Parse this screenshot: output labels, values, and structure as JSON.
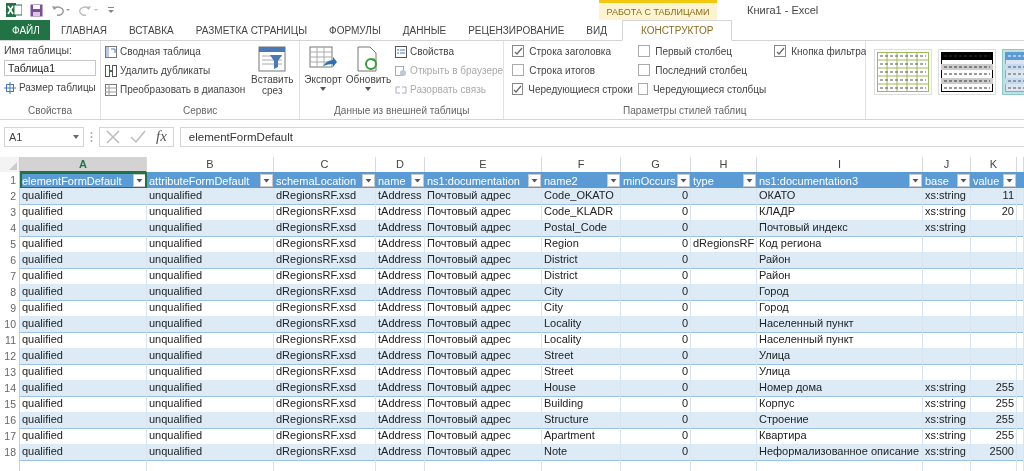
{
  "title_bar": {
    "title": "Книга1 - Excel",
    "context_group": "РАБОТА С ТАБЛИЦАМИ"
  },
  "tabs": [
    {
      "label": "ФАЙЛ",
      "kind": "file",
      "selected": false
    },
    {
      "label": "ГЛАВНАЯ",
      "kind": "normal",
      "selected": false
    },
    {
      "label": "ВСТАВКА",
      "kind": "normal",
      "selected": false
    },
    {
      "label": "РАЗМЕТКА СТРАНИЦЫ",
      "kind": "normal",
      "selected": false
    },
    {
      "label": "ФОРМУЛЫ",
      "kind": "normal",
      "selected": false
    },
    {
      "label": "ДАННЫЕ",
      "kind": "normal",
      "selected": false
    },
    {
      "label": "РЕЦЕНЗИРОВАНИЕ",
      "kind": "normal",
      "selected": false
    },
    {
      "label": "ВИД",
      "kind": "normal",
      "selected": false
    },
    {
      "label": "КОНСТРУКТОР",
      "kind": "context",
      "selected": true
    }
  ],
  "ribbon": {
    "properties": {
      "name_label": "Имя таблицы:",
      "name_value": "Таблица1",
      "resize": "Размер таблицы",
      "group": "Свойства"
    },
    "tools": {
      "items": [
        {
          "label": "Сводная таблица"
        },
        {
          "label": "Удалить дубликаты"
        },
        {
          "label": "Преобразовать в диапазон"
        }
      ],
      "slicer": "Вставить срез",
      "group": "Сервис"
    },
    "external": {
      "large": [
        {
          "label": "Экспорт"
        },
        {
          "label": "Обновить"
        }
      ],
      "items": [
        {
          "label": "Свойства",
          "disabled": false
        },
        {
          "label": "Открыть в браузере",
          "disabled": true
        },
        {
          "label": "Разорвать связь",
          "disabled": true
        }
      ],
      "group": "Данные из внешней таблицы"
    },
    "style_options": {
      "columns": [
        [
          {
            "label": "Строка заголовка",
            "checked": true
          },
          {
            "label": "Строка итогов",
            "checked": false
          },
          {
            "label": "Чередующиеся строки",
            "checked": true
          }
        ],
        [
          {
            "label": "Первый столбец",
            "checked": false
          },
          {
            "label": "Последний столбец",
            "checked": false
          },
          {
            "label": "Чередующиеся столбцы",
            "checked": false
          }
        ],
        [
          {
            "label": "Кнопка фильтра",
            "checked": true
          }
        ]
      ],
      "group": "Параметры стилей таблиц"
    }
  },
  "formula_bar": {
    "name_box": "A1",
    "fx": "fx",
    "value": "elementFormDefault"
  },
  "sheet": {
    "column_letters": [
      {
        "label": "A",
        "selected": true
      },
      {
        "label": "B",
        "selected": false
      },
      {
        "label": "C",
        "selected": false
      },
      {
        "label": "D",
        "selected": false
      },
      {
        "label": "E",
        "selected": false
      },
      {
        "label": "F",
        "selected": false
      },
      {
        "label": "G",
        "selected": false
      },
      {
        "label": "H",
        "selected": false
      },
      {
        "label": "I",
        "selected": false
      },
      {
        "label": "J",
        "selected": false
      },
      {
        "label": "K",
        "selected": false
      }
    ],
    "columns": [
      {
        "header": "elementFormDefault",
        "kind": "text",
        "active": true
      },
      {
        "header": "attributeFormDefault",
        "kind": "text",
        "active": false
      },
      {
        "header": "schemaLocation",
        "kind": "text",
        "active": false
      },
      {
        "header": "name",
        "kind": "text",
        "active": false
      },
      {
        "header": "ns1:documentation",
        "kind": "text",
        "active": false
      },
      {
        "header": "name2",
        "kind": "text",
        "active": false
      },
      {
        "header": "minOccurs",
        "kind": "number",
        "active": false
      },
      {
        "header": "type",
        "kind": "text",
        "active": false
      },
      {
        "header": "ns1:documentation3",
        "kind": "text",
        "active": false
      },
      {
        "header": "base",
        "kind": "text",
        "active": false
      },
      {
        "header": "value",
        "kind": "number",
        "active": false
      }
    ],
    "row_numbers": [
      "1",
      "2",
      "3",
      "4",
      "5",
      "6",
      "7",
      "8",
      "9",
      "10",
      "11",
      "12",
      "13",
      "14",
      "15",
      "16",
      "17",
      "18"
    ],
    "rows": [
      [
        "qualified",
        "unqualified",
        "dRegionsRF.xsd",
        "tAddress",
        "Почтовый адрес",
        "Code_OKATO",
        "0",
        null,
        "ОКАТО",
        "xs:string",
        "11"
      ],
      [
        "qualified",
        "unqualified",
        "dRegionsRF.xsd",
        "tAddress",
        "Почтовый адрес",
        "Code_KLADR",
        "0",
        null,
        "КЛАДР",
        "xs:string",
        "20"
      ],
      [
        "qualified",
        "unqualified",
        "dRegionsRF.xsd",
        "tAddress",
        "Почтовый адрес",
        "Postal_Code",
        "0",
        null,
        "Почтовый индекс",
        "xs:string",
        null
      ],
      [
        "qualified",
        "unqualified",
        "dRegionsRF.xsd",
        "tAddress",
        "Почтовый адрес",
        "Region",
        "0",
        "dRegionsRF",
        "Код региона",
        null,
        null
      ],
      [
        "qualified",
        "unqualified",
        "dRegionsRF.xsd",
        "tAddress",
        "Почтовый адрес",
        "District",
        "0",
        null,
        "Район",
        null,
        null
      ],
      [
        "qualified",
        "unqualified",
        "dRegionsRF.xsd",
        "tAddress",
        "Почтовый адрес",
        "District",
        "0",
        null,
        "Район",
        null,
        null
      ],
      [
        "qualified",
        "unqualified",
        "dRegionsRF.xsd",
        "tAddress",
        "Почтовый адрес",
        "City",
        "0",
        null,
        "Город",
        null,
        null
      ],
      [
        "qualified",
        "unqualified",
        "dRegionsRF.xsd",
        "tAddress",
        "Почтовый адрес",
        "City",
        "0",
        null,
        "Город",
        null,
        null
      ],
      [
        "qualified",
        "unqualified",
        "dRegionsRF.xsd",
        "tAddress",
        "Почтовый адрес",
        "Locality",
        "0",
        null,
        "Населенный пункт",
        null,
        null
      ],
      [
        "qualified",
        "unqualified",
        "dRegionsRF.xsd",
        "tAddress",
        "Почтовый адрес",
        "Locality",
        "0",
        null,
        "Населенный пункт",
        null,
        null
      ],
      [
        "qualified",
        "unqualified",
        "dRegionsRF.xsd",
        "tAddress",
        "Почтовый адрес",
        "Street",
        "0",
        null,
        "Улица",
        null,
        null
      ],
      [
        "qualified",
        "unqualified",
        "dRegionsRF.xsd",
        "tAddress",
        "Почтовый адрес",
        "Street",
        "0",
        null,
        "Улица",
        null,
        null
      ],
      [
        "qualified",
        "unqualified",
        "dRegionsRF.xsd",
        "tAddress",
        "Почтовый адрес",
        "House",
        "0",
        null,
        "Номер дома",
        "xs:string",
        "255"
      ],
      [
        "qualified",
        "unqualified",
        "dRegionsRF.xsd",
        "tAddress",
        "Почтовый адрес",
        "Building",
        "0",
        null,
        "Корпус",
        "xs:string",
        "255"
      ],
      [
        "qualified",
        "unqualified",
        "dRegionsRF.xsd",
        "tAddress",
        "Почтовый адрес",
        "Structure",
        "0",
        null,
        "Строение",
        "xs:string",
        "255"
      ],
      [
        "qualified",
        "unqualified",
        "dRegionsRF.xsd",
        "tAddress",
        "Почтовый адрес",
        "Apartment",
        "0",
        null,
        "Квартира",
        "xs:string",
        "255"
      ],
      [
        "qualified",
        "unqualified",
        "dRegionsRF.xsd",
        "tAddress",
        "Почтовый адрес",
        "Note",
        "0",
        null,
        "Неформализованное описание",
        "xs:string",
        "2500"
      ]
    ]
  }
}
